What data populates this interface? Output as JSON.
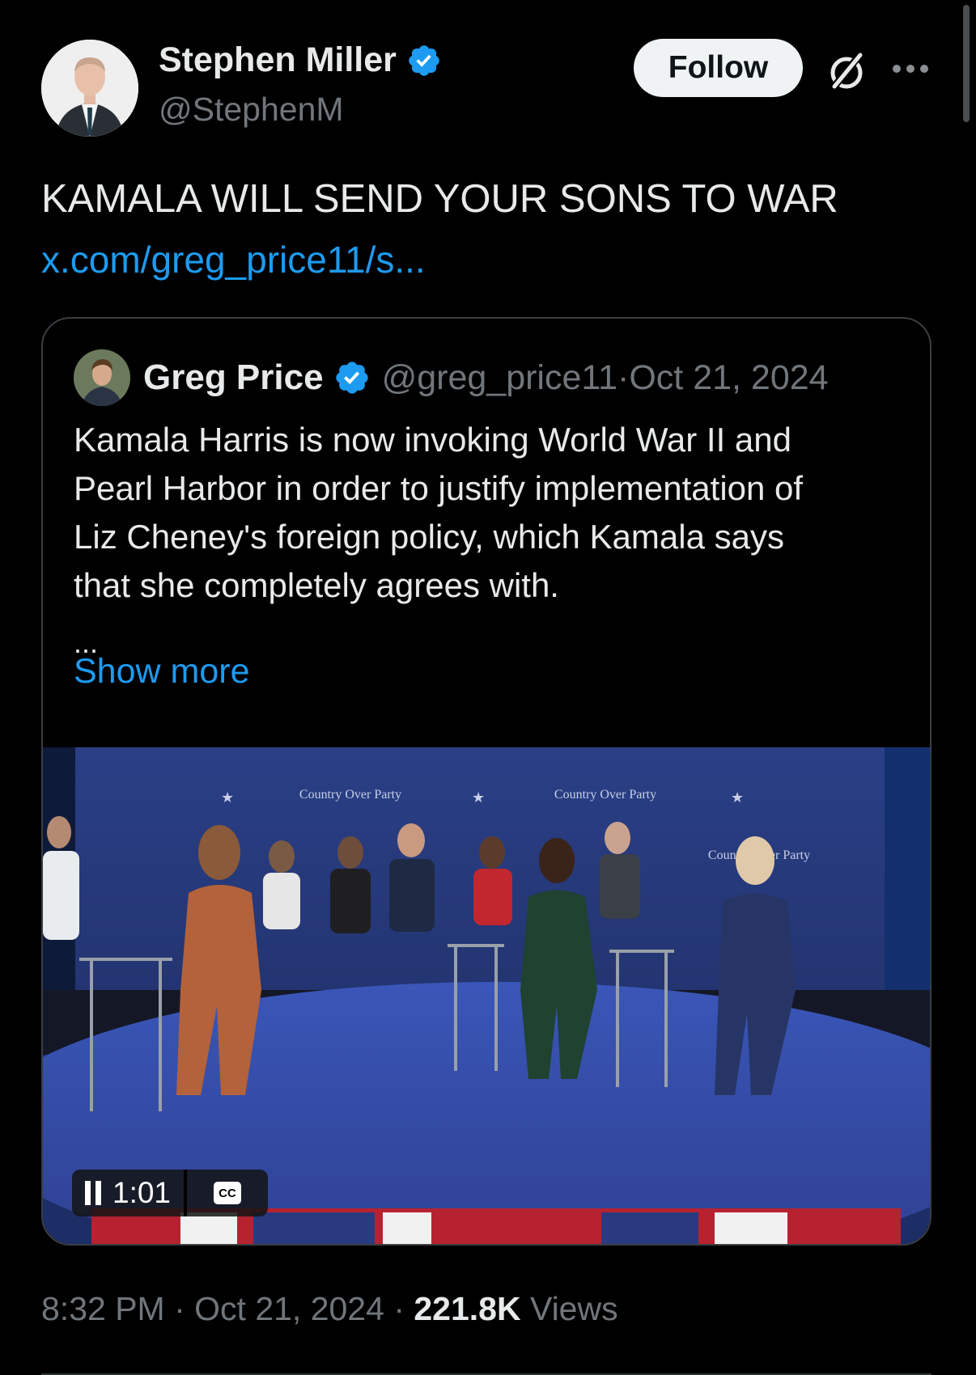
{
  "author": {
    "display_name": "Stephen Miller",
    "handle": "@StephenM",
    "verified": true
  },
  "actions": {
    "follow_label": "Follow",
    "grok_icon": "grok-icon",
    "more_icon": "more-dots-icon"
  },
  "tweet": {
    "text": "KAMALA WILL SEND YOUR SONS TO WAR",
    "link": "x.com/greg_price11/s..."
  },
  "quote": {
    "display_name": "Greg Price",
    "handle": "@greg_price11",
    "date_sep": " · ",
    "date": "Oct 21, 2024",
    "body_lines": [
      "Kamala Harris is now invoking World War II and",
      "Pearl Harbor in order to justify implementation of",
      "Liz Cheney's foreign policy, which Kamala says",
      "that she completely agrees with."
    ],
    "ellipsis": "...",
    "show_more": "Show more",
    "video": {
      "time": "1:01",
      "cc_label": "CC",
      "backdrop_text": "Country Over Party"
    }
  },
  "meta": {
    "time": "8:32 PM",
    "sep1": " · ",
    "date": "Oct 21, 2024",
    "sep2": " · ",
    "views_count": "221.8K",
    "views_label": " Views"
  },
  "colors": {
    "background": "#000000",
    "link": "#1d9bf0",
    "verified": "#1d9bf0",
    "muted": "#71767b"
  }
}
